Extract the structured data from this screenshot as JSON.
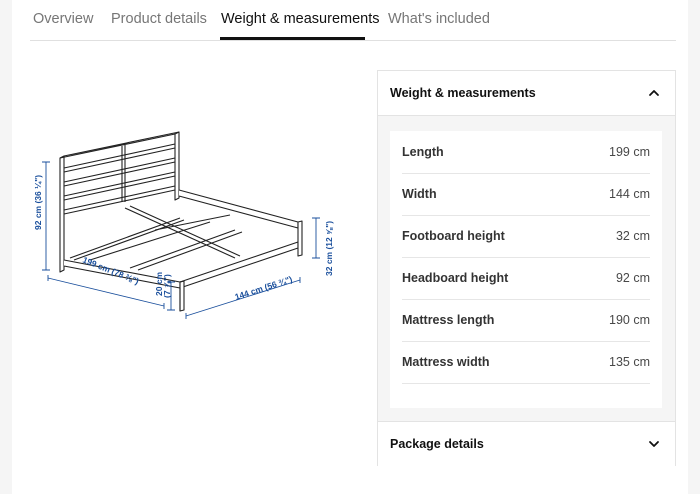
{
  "tabs": [
    {
      "label": "Overview"
    },
    {
      "label": "Product details"
    },
    {
      "label": "Weight & measurements"
    },
    {
      "label": "What's included"
    }
  ],
  "active_tab": 2,
  "drawing": {
    "dims": {
      "headboard": "92 cm (36 ¼\")",
      "length": "199 cm (78 ⅜\")",
      "underbed": "20 cm",
      "underbed_in": "(7 ⅞\")",
      "width": "144 cm (56 ¾\")",
      "footboard": "32 cm (12 ⅝\")"
    },
    "dim_color": "#1a4f9c"
  },
  "panel": {
    "title": "Weight & measurements",
    "specs": [
      {
        "label": "Length",
        "value": "199 cm"
      },
      {
        "label": "Width",
        "value": "144 cm"
      },
      {
        "label": "Footboard height",
        "value": "32 cm"
      },
      {
        "label": "Headboard height",
        "value": "92 cm"
      },
      {
        "label": "Mattress length",
        "value": "190 cm"
      },
      {
        "label": "Mattress width",
        "value": "135 cm"
      }
    ],
    "package_title": "Package details"
  }
}
